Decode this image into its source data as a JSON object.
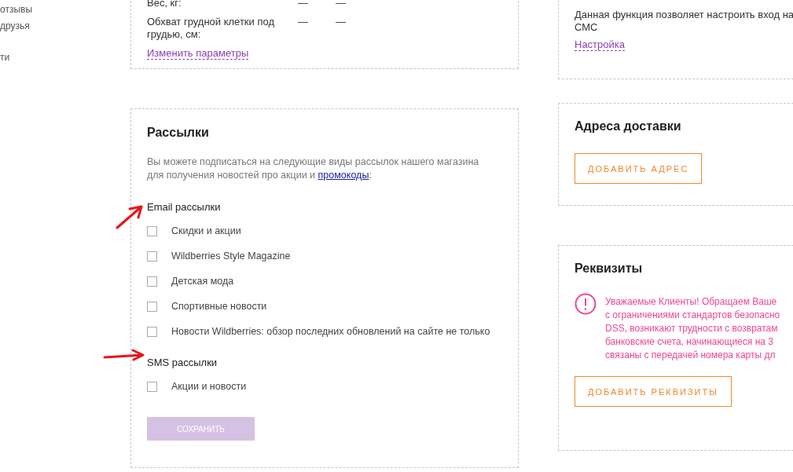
{
  "sidebar": {
    "items": [
      {
        "label": "отзывы"
      },
      {
        "label": "друзья"
      },
      {
        "label": "ти"
      }
    ]
  },
  "parameters": {
    "rows": [
      {
        "label": "Вес, кг:",
        "value_1": "—",
        "value_2": "—"
      },
      {
        "label": "Обхват грудной клетки под грудью, см:",
        "value_1": "—",
        "value_2": "—"
      }
    ],
    "link": "Изменить параметры"
  },
  "sms_login": {
    "text": "Данная функция позволяет настроить вход на СМС",
    "link": "Настройка"
  },
  "newsletters": {
    "title": "Рассылки",
    "description_before": "Вы можете подписаться на следующие виды рассылок нашего магазина для получения новостей про акции и ",
    "description_link": "промокоды",
    "description_after": ":",
    "groups": [
      {
        "title": "Email рассылки",
        "options": [
          {
            "label": "Скидки и акции",
            "checked": false
          },
          {
            "label": "Wildberries Style Magazine",
            "checked": false
          },
          {
            "label": "Детская мода",
            "checked": false
          },
          {
            "label": "Спортивные новости",
            "checked": false
          },
          {
            "label": "Новости Wildberries: обзор последних обновлений на сайте не только",
            "checked": false
          }
        ]
      },
      {
        "title": "SMS рассылки",
        "options": [
          {
            "label": "Акции и новости",
            "checked": false
          }
        ]
      }
    ],
    "save_button": {
      "label": "СОХРАНИТЬ",
      "disabled": true
    }
  },
  "delivery": {
    "title": "Адреса доставки",
    "button": "ДОБАВИТЬ АДРЕС"
  },
  "requisites": {
    "title": "Реквизиты",
    "notice_lines": [
      "Уважаемые Клиенты! Обращаем Ваше",
      "с ограничениями стандартов безопасно",
      "DSS, возникают трудности с возвратам",
      "банковские счета, начинающиеся на 3",
      "связаны с передачей номера карты дл"
    ],
    "button": "ДОБАВИТЬ РЕКВИЗИТЫ"
  }
}
